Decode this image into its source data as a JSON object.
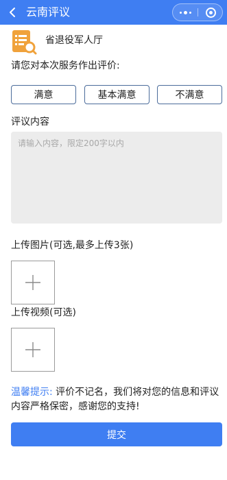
{
  "navbar": {
    "title": "云南评议",
    "back_icon": "chevron-left-icon",
    "more_icon": "more-dots-icon",
    "close_icon": "target-circle-icon",
    "bg_color": "#3f7ef2"
  },
  "department": {
    "name": "省退役军人厅",
    "icon": "document-search-icon",
    "icon_color": "#f0a23b"
  },
  "rating": {
    "prompt": "请您对本次服务作出评价:",
    "options": [
      "满意",
      "基本满意",
      "不满意"
    ]
  },
  "comment": {
    "label": "评议内容",
    "placeholder": "请输入内容，限定200字以内",
    "value": ""
  },
  "upload_image": {
    "label": "上传图片(可选,最多上传3张)",
    "icon": "plus-icon"
  },
  "upload_video": {
    "label": "上传视频(可选)",
    "icon": "plus-icon"
  },
  "tips": {
    "label": "温馨提示:",
    "text": "评价不记名，我们将对您的信息和评议内容严格保密，感谢您的支持!"
  },
  "submit": {
    "label": "提交"
  }
}
